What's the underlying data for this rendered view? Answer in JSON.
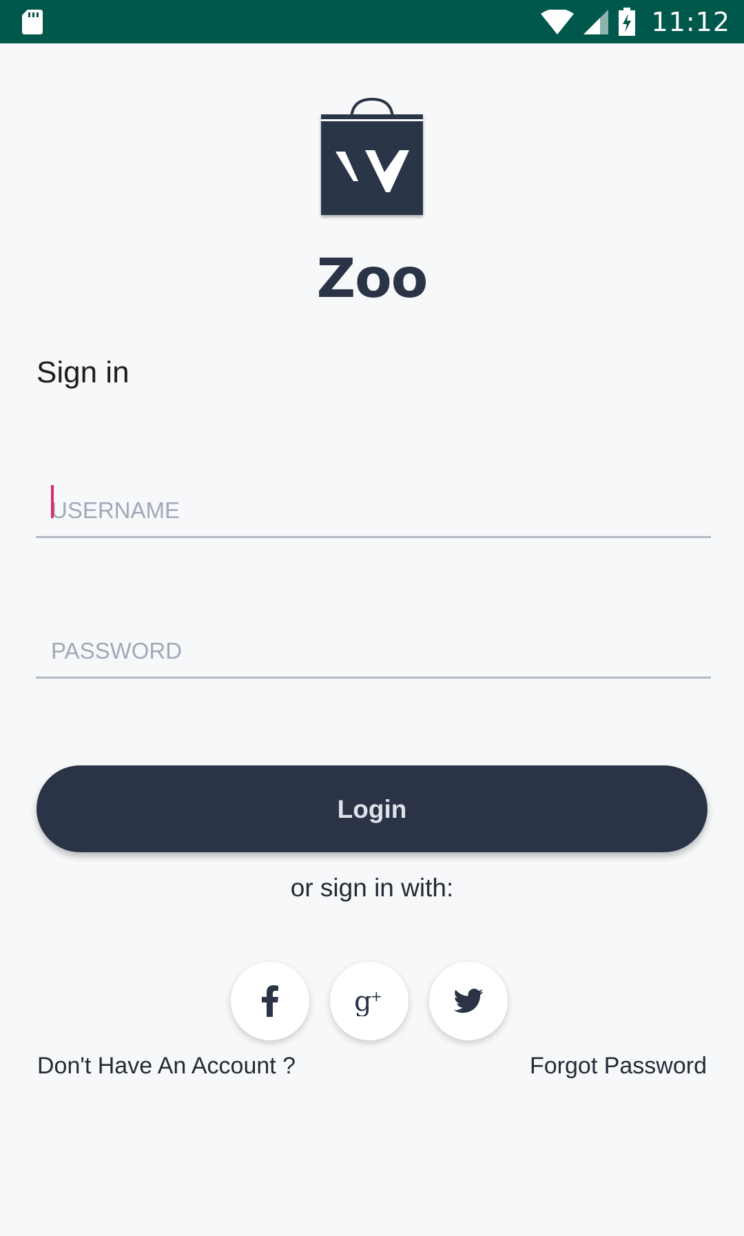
{
  "status_bar": {
    "time": "11:12",
    "icons": [
      "sd-card-icon",
      "wifi-icon",
      "cell-signal-icon",
      "battery-charging-icon"
    ]
  },
  "app": {
    "name": "Zoo",
    "logo_icon": "shopping-bag-logo",
    "logo_color": "#2b3446"
  },
  "form": {
    "heading": "Sign in",
    "username_placeholder": "USERNAME",
    "password_placeholder": "PASSWORD",
    "login_label": "Login",
    "alt_signin_text": "or sign in with:"
  },
  "social": [
    {
      "icon": "facebook-icon"
    },
    {
      "icon": "google-plus-icon"
    },
    {
      "icon": "twitter-icon"
    }
  ],
  "links": {
    "no_account": "Don't Have An Account ?",
    "forgot_password": "Forgot Password"
  },
  "colors": {
    "status_bar": "#00574b",
    "primary": "#2b3446",
    "accent_caret": "#e0286a",
    "background": "#f7f8fa"
  }
}
